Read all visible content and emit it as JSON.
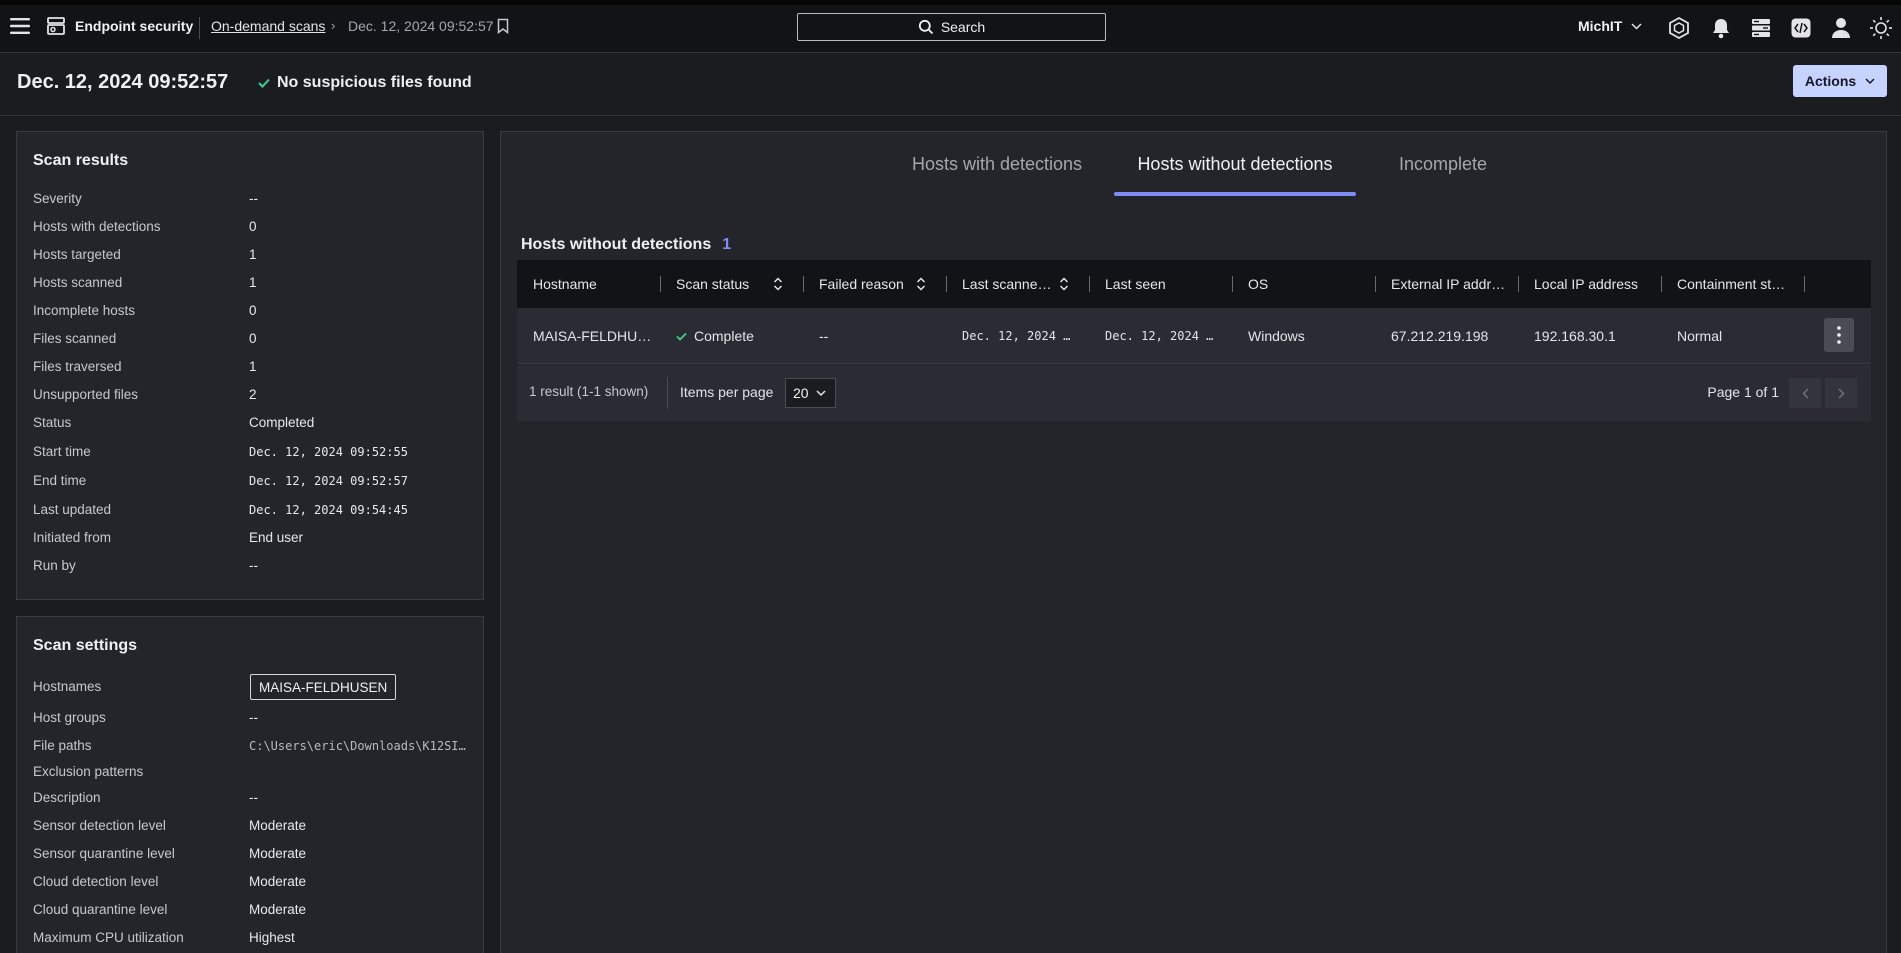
{
  "app": {
    "product": "Endpoint security",
    "breadcrumb_link": "On-demand scans",
    "breadcrumb_current": "Dec. 12, 2024 09:52:57",
    "search_label": "Search",
    "account_name": "MichIT",
    "icons": [
      "hamburger-menu-icon",
      "product-logo-icon",
      "bookmark-icon",
      "search-icon",
      "chevron-down-icon",
      "hexagon-badge-icon",
      "bell-icon",
      "stack-icon",
      "code-icon",
      "user-icon",
      "sun-icon"
    ]
  },
  "header": {
    "title": "Dec. 12, 2024 09:52:57",
    "status": "No suspicious files found",
    "actions_label": "Actions"
  },
  "scan_results": {
    "title": "Scan results",
    "rows": [
      {
        "label": "Severity",
        "value": "--"
      },
      {
        "label": "Hosts with detections",
        "value": "0"
      },
      {
        "label": "Hosts targeted",
        "value": "1"
      },
      {
        "label": "Hosts scanned",
        "value": "1"
      },
      {
        "label": "Incomplete hosts",
        "value": "0"
      },
      {
        "label": "Files scanned",
        "value": "0"
      },
      {
        "label": "Files traversed",
        "value": "1"
      },
      {
        "label": "Unsupported files",
        "value": "2"
      },
      {
        "label": "Status",
        "value": "Completed"
      },
      {
        "label": "Start time",
        "value": "Dec. 12, 2024 09:52:55"
      },
      {
        "label": "End time",
        "value": "Dec. 12, 2024 09:52:57"
      },
      {
        "label": "Last updated",
        "value": "Dec. 12, 2024 09:54:45"
      },
      {
        "label": "Initiated from",
        "value": "End user"
      },
      {
        "label": "Run by",
        "value": "--"
      }
    ]
  },
  "scan_settings": {
    "title": "Scan settings",
    "hostnames_label": "Hostnames",
    "hostname_chip": "MAISA-FELDHUSEN",
    "rows": [
      {
        "label": "Host groups",
        "value": "--"
      },
      {
        "label": "File paths",
        "value": "C:\\Users\\eric\\Downloads\\K12SI…"
      },
      {
        "label": "Exclusion patterns",
        "value": ""
      },
      {
        "label": "Description",
        "value": "--"
      },
      {
        "label": "Sensor detection level",
        "value": "Moderate"
      },
      {
        "label": "Sensor quarantine level",
        "value": "Moderate"
      },
      {
        "label": "Cloud detection level",
        "value": "Moderate"
      },
      {
        "label": "Cloud quarantine level",
        "value": "Moderate"
      },
      {
        "label": "Maximum CPU utilization",
        "value": "Highest"
      }
    ]
  },
  "tabs": [
    {
      "label": "Hosts with detections",
      "active": false
    },
    {
      "label": "Hosts without detections",
      "active": true
    },
    {
      "label": "Incomplete",
      "active": false
    }
  ],
  "table": {
    "title": "Hosts without detections",
    "count": "1",
    "columns": [
      "Hostname",
      "Scan status",
      "Failed reason",
      "Last scanne…",
      "Last seen",
      "OS",
      "External IP addr…",
      "Local IP address",
      "Containment st…"
    ],
    "rows": [
      {
        "hostname": "MAISA-FELDHU…",
        "scan_status": "Complete",
        "failed_reason": "--",
        "last_scanned": "Dec. 12, 2024 …",
        "last_seen": "Dec. 12, 2024 …",
        "os": "Windows",
        "external_ip": "67.212.219.198",
        "local_ip": "192.168.30.1",
        "containment": "Normal"
      }
    ]
  },
  "pagination": {
    "summary": "1 result (1-1 shown)",
    "items_per_page_label": "Items per page",
    "items_per_page": "20",
    "page_label": "Page 1 of 1"
  },
  "colors": {
    "accent": "#7f8cf5",
    "success": "#3ccf8e",
    "actions_bg": "#c7d3ff"
  }
}
